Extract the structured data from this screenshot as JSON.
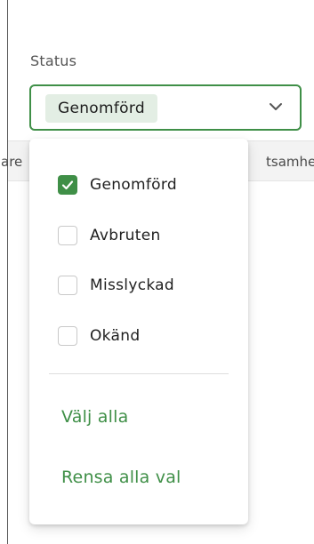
{
  "filter": {
    "label": "Status",
    "selected_value": "Genomförd",
    "chevron_icon": "chevron-down-icon"
  },
  "table_header": {
    "left_fragment": "are",
    "right_fragment": "tsamhe"
  },
  "dropdown": {
    "options": [
      {
        "label": "Genomförd",
        "checked": true
      },
      {
        "label": "Avbruten",
        "checked": false
      },
      {
        "label": "Misslyckad",
        "checked": false
      },
      {
        "label": "Okänd",
        "checked": false
      }
    ],
    "select_all_label": "Välj alla",
    "clear_all_label": "Rensa alla val"
  },
  "colors": {
    "accent": "#3f8f47",
    "chip_background": "#e3eee4"
  }
}
